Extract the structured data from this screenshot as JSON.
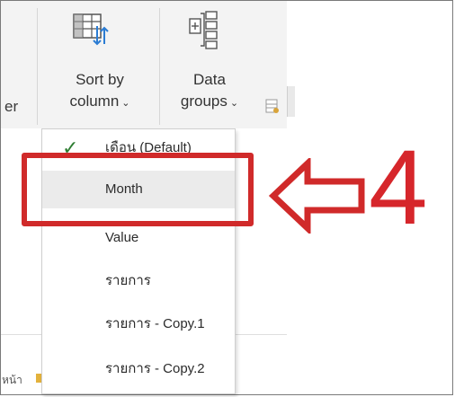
{
  "ribbon": {
    "partial_left_label": "er",
    "sort_by_column": {
      "line1": "Sort by",
      "line2": "column"
    },
    "data_groups": {
      "line1": "Data",
      "line2": "groups"
    },
    "chevron": "⌄"
  },
  "dropdown": {
    "check_glyph": "✓",
    "items": [
      {
        "label": "เดือน (Default)",
        "checked": true
      },
      {
        "label": "Month",
        "highlighted": true
      },
      {
        "label": "Value"
      },
      {
        "label": "รายการ"
      },
      {
        "label": "รายการ - Copy.1"
      },
      {
        "label": "รายการ - Copy.2"
      }
    ]
  },
  "annotation": {
    "step_number": "4",
    "color": "#d02a2a"
  },
  "bottom": {
    "partial_text": "หน้า"
  },
  "colors": {
    "ribbon_bg": "#f3f3f3",
    "highlight": "#ebebeb",
    "check": "#2e7d32"
  }
}
